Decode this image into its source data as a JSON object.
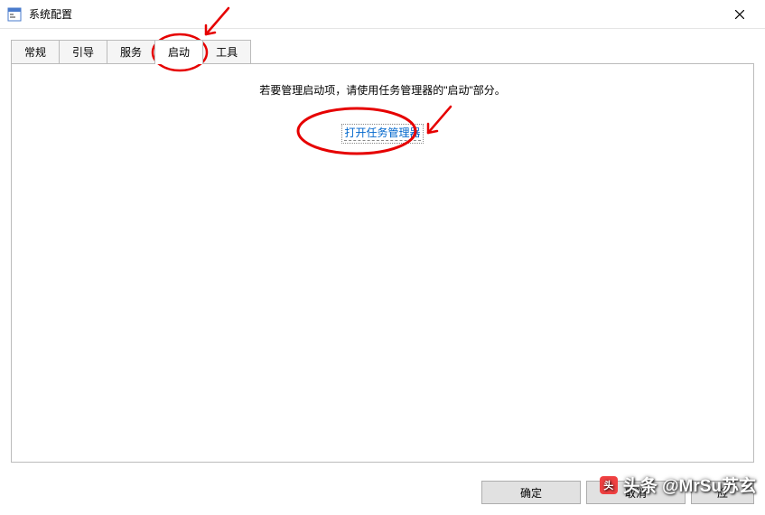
{
  "window": {
    "title": "系统配置"
  },
  "tabs": {
    "general": "常规",
    "boot": "引导",
    "services": "服务",
    "startup": "启动",
    "tools": "工具"
  },
  "content": {
    "message": "若要管理启动项，请使用任务管理器的\"启动\"部分。",
    "link": "打开任务管理器"
  },
  "buttons": {
    "ok": "确定",
    "cancel": "取消",
    "apply_partial": "应"
  },
  "watermark": {
    "text": "头条 @MrSu苏玄"
  },
  "annotation_color": "#e60000"
}
